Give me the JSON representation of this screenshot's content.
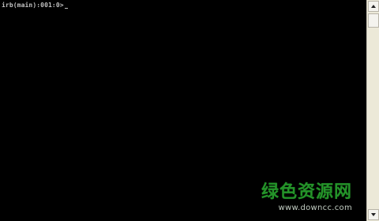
{
  "terminal": {
    "prompt": "irb(main):001:0>"
  },
  "watermark": {
    "main": "绿色资源网",
    "sub": "www.downcc.com"
  },
  "icons": {
    "scroll_up": "chevron-up-icon",
    "scroll_down": "chevron-down-icon"
  },
  "colors": {
    "terminal_background": "#000000",
    "terminal_text": "#c0c0c0",
    "watermark_green": "#29a82f",
    "scrollbar_track": "#ece9d8"
  }
}
